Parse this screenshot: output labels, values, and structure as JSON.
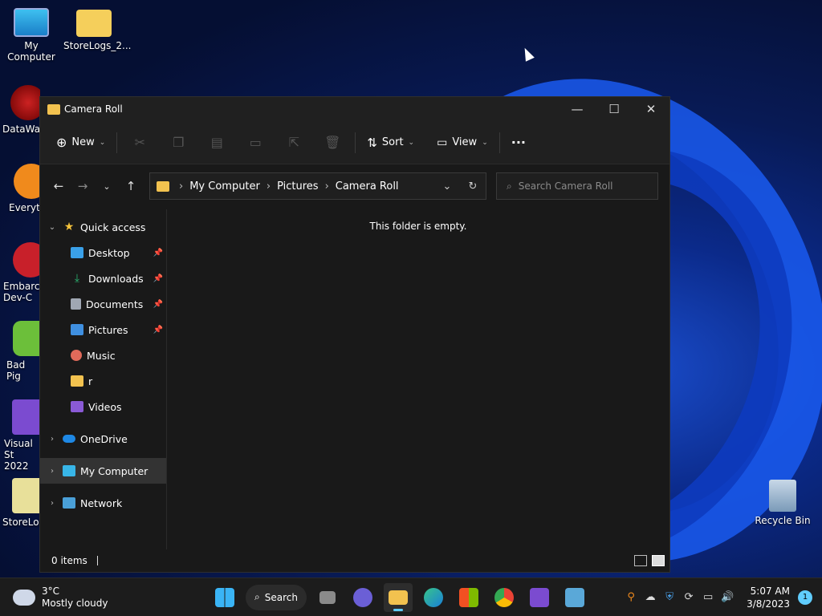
{
  "desktop": {
    "icons": [
      {
        "label": "My Computer"
      },
      {
        "label": "StoreLogs_2..."
      },
      {
        "label": "DataWag"
      },
      {
        "label": "Everyth"
      },
      {
        "label": "Embarca Dev-C"
      },
      {
        "label": "Bad Pig"
      },
      {
        "label": "Visual St 2022"
      },
      {
        "label": "StoreLog"
      },
      {
        "label": "Recycle Bin"
      }
    ]
  },
  "window": {
    "title": "Camera Roll",
    "controls": {
      "minimize": "—",
      "maximize": "☐",
      "close": "✕"
    }
  },
  "toolbar": {
    "new_label": "New",
    "sort_label": "Sort",
    "view_label": "View",
    "more_label": "···"
  },
  "address": {
    "crumbs": [
      "My Computer",
      "Pictures",
      "Camera Roll"
    ],
    "search_placeholder": "Search Camera Roll"
  },
  "nav": {
    "quick_access": "Quick access",
    "items": [
      {
        "label": "Desktop",
        "pinned": true,
        "color": "#3aa0e8"
      },
      {
        "label": "Downloads",
        "pinned": true,
        "color": "#2bb673"
      },
      {
        "label": "Documents",
        "pinned": true,
        "color": "#a0a7b3"
      },
      {
        "label": "Pictures",
        "pinned": true,
        "color": "#3f8fe0"
      },
      {
        "label": "Music",
        "pinned": false,
        "color": "#e06a5a"
      },
      {
        "label": "r",
        "pinned": false,
        "color": "#f2c24f"
      },
      {
        "label": "Videos",
        "pinned": false,
        "color": "#8a5ad6"
      }
    ],
    "onedrive": "OneDrive",
    "my_computer": "My Computer",
    "network": "Network"
  },
  "content": {
    "empty_message": "This folder is empty."
  },
  "status": {
    "item_count": "0 items"
  },
  "taskbar": {
    "weather_temp": "3°C",
    "weather_desc": "Mostly cloudy",
    "search_label": "Search",
    "time": "5:07 AM",
    "date": "3/8/2023",
    "notification_count": "1"
  }
}
